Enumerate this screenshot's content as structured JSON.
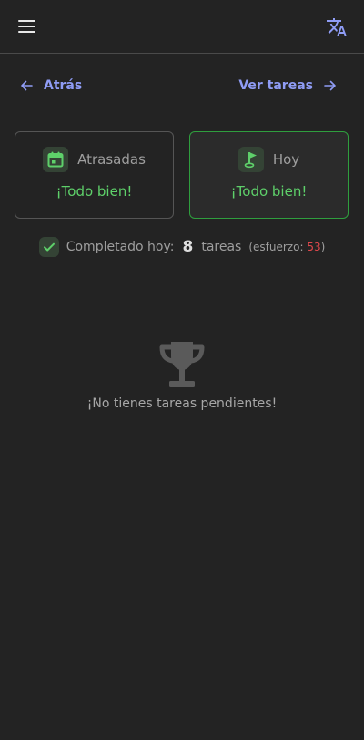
{
  "topbar": {
    "menu_icon": "hamburger-menu-icon",
    "translate_icon": "translate-icon"
  },
  "nav": {
    "back_label": "Atrás",
    "back_icon": "arrow-left-icon",
    "forward_label": "Ver tareas",
    "forward_icon": "arrow-right-icon"
  },
  "cards": [
    {
      "title": "Atrasadas",
      "status": "¡Todo bien!",
      "icon": "calendar-icon",
      "selected": false
    },
    {
      "title": "Hoy",
      "status": "¡Todo bien!",
      "icon": "golf-flag-icon",
      "selected": true
    }
  ],
  "completed": {
    "label": "Completado hoy:",
    "count": "8",
    "unit": "tareas",
    "effort_open": "(esfuerzo: ",
    "effort_value": "53",
    "effort_close": ")"
  },
  "empty": {
    "icon": "trophy-icon",
    "message": "¡No tienes tareas pendientes!"
  },
  "colors": {
    "background": "#232323",
    "accent_link": "#8f9cf5",
    "success": "#5ed06a",
    "selected_border": "#2f9e3e",
    "effort": "#e0484c"
  }
}
